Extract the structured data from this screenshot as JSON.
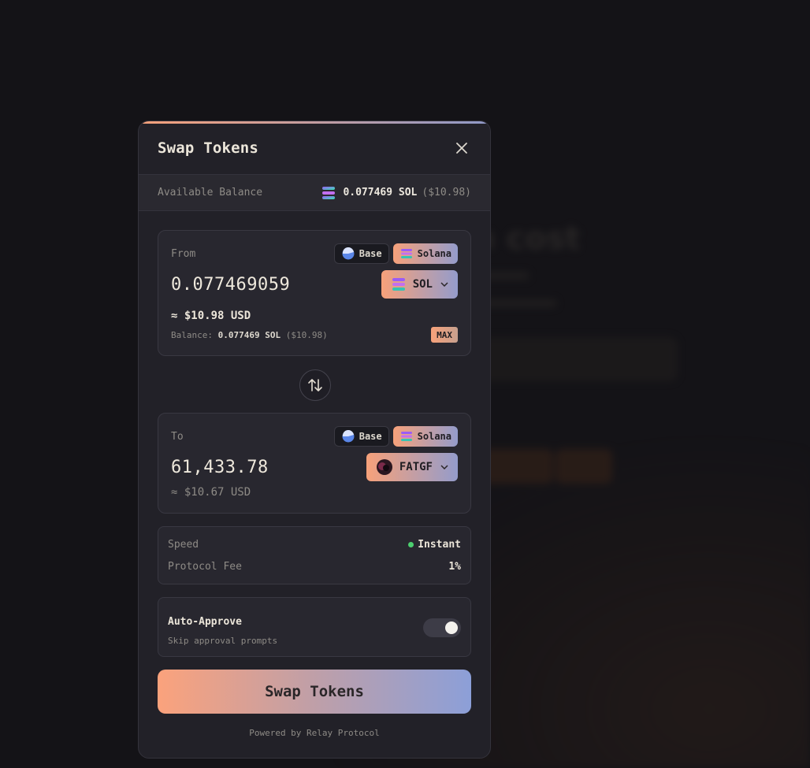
{
  "modal": {
    "title": "Swap Tokens",
    "close_icon": "close-icon"
  },
  "balance": {
    "label": "Available Balance",
    "amount": "0.077469 SOL",
    "usd": "($10.98)",
    "icon": "solana-icon"
  },
  "from": {
    "label": "From",
    "chains": [
      {
        "label": "Base",
        "icon": "base-icon",
        "selected": false
      },
      {
        "label": "Solana",
        "icon": "solana-icon",
        "selected": true
      }
    ],
    "amount": "0.077469059",
    "token": "SOL",
    "usd": "≈ $10.98 USD",
    "balance_label": "Balance:",
    "balance_amount": "0.077469 SOL",
    "balance_usd": "($10.98)",
    "max_label": "MAX"
  },
  "swap_direction_icon": "swap-arrows-icon",
  "to": {
    "label": "To",
    "chains": [
      {
        "label": "Base",
        "icon": "base-icon",
        "selected": false
      },
      {
        "label": "Solana",
        "icon": "solana-icon",
        "selected": true
      }
    ],
    "amount": "61,433.78",
    "token": "FATGF",
    "usd": "≈ $10.67 USD"
  },
  "details": {
    "speed_label": "Speed",
    "speed_value": "Instant",
    "fee_label": "Protocol Fee",
    "fee_value": "1%"
  },
  "auto_approve": {
    "title": "Auto-Approve",
    "subtitle": "Skip approval prompts",
    "enabled": true
  },
  "submit_label": "Swap Tokens",
  "footer": "Powered by Relay Protocol",
  "colors": {
    "gradient_start": "#f7a17a",
    "gradient_end": "#8f99c8",
    "status_green": "#4ccf6f"
  }
}
